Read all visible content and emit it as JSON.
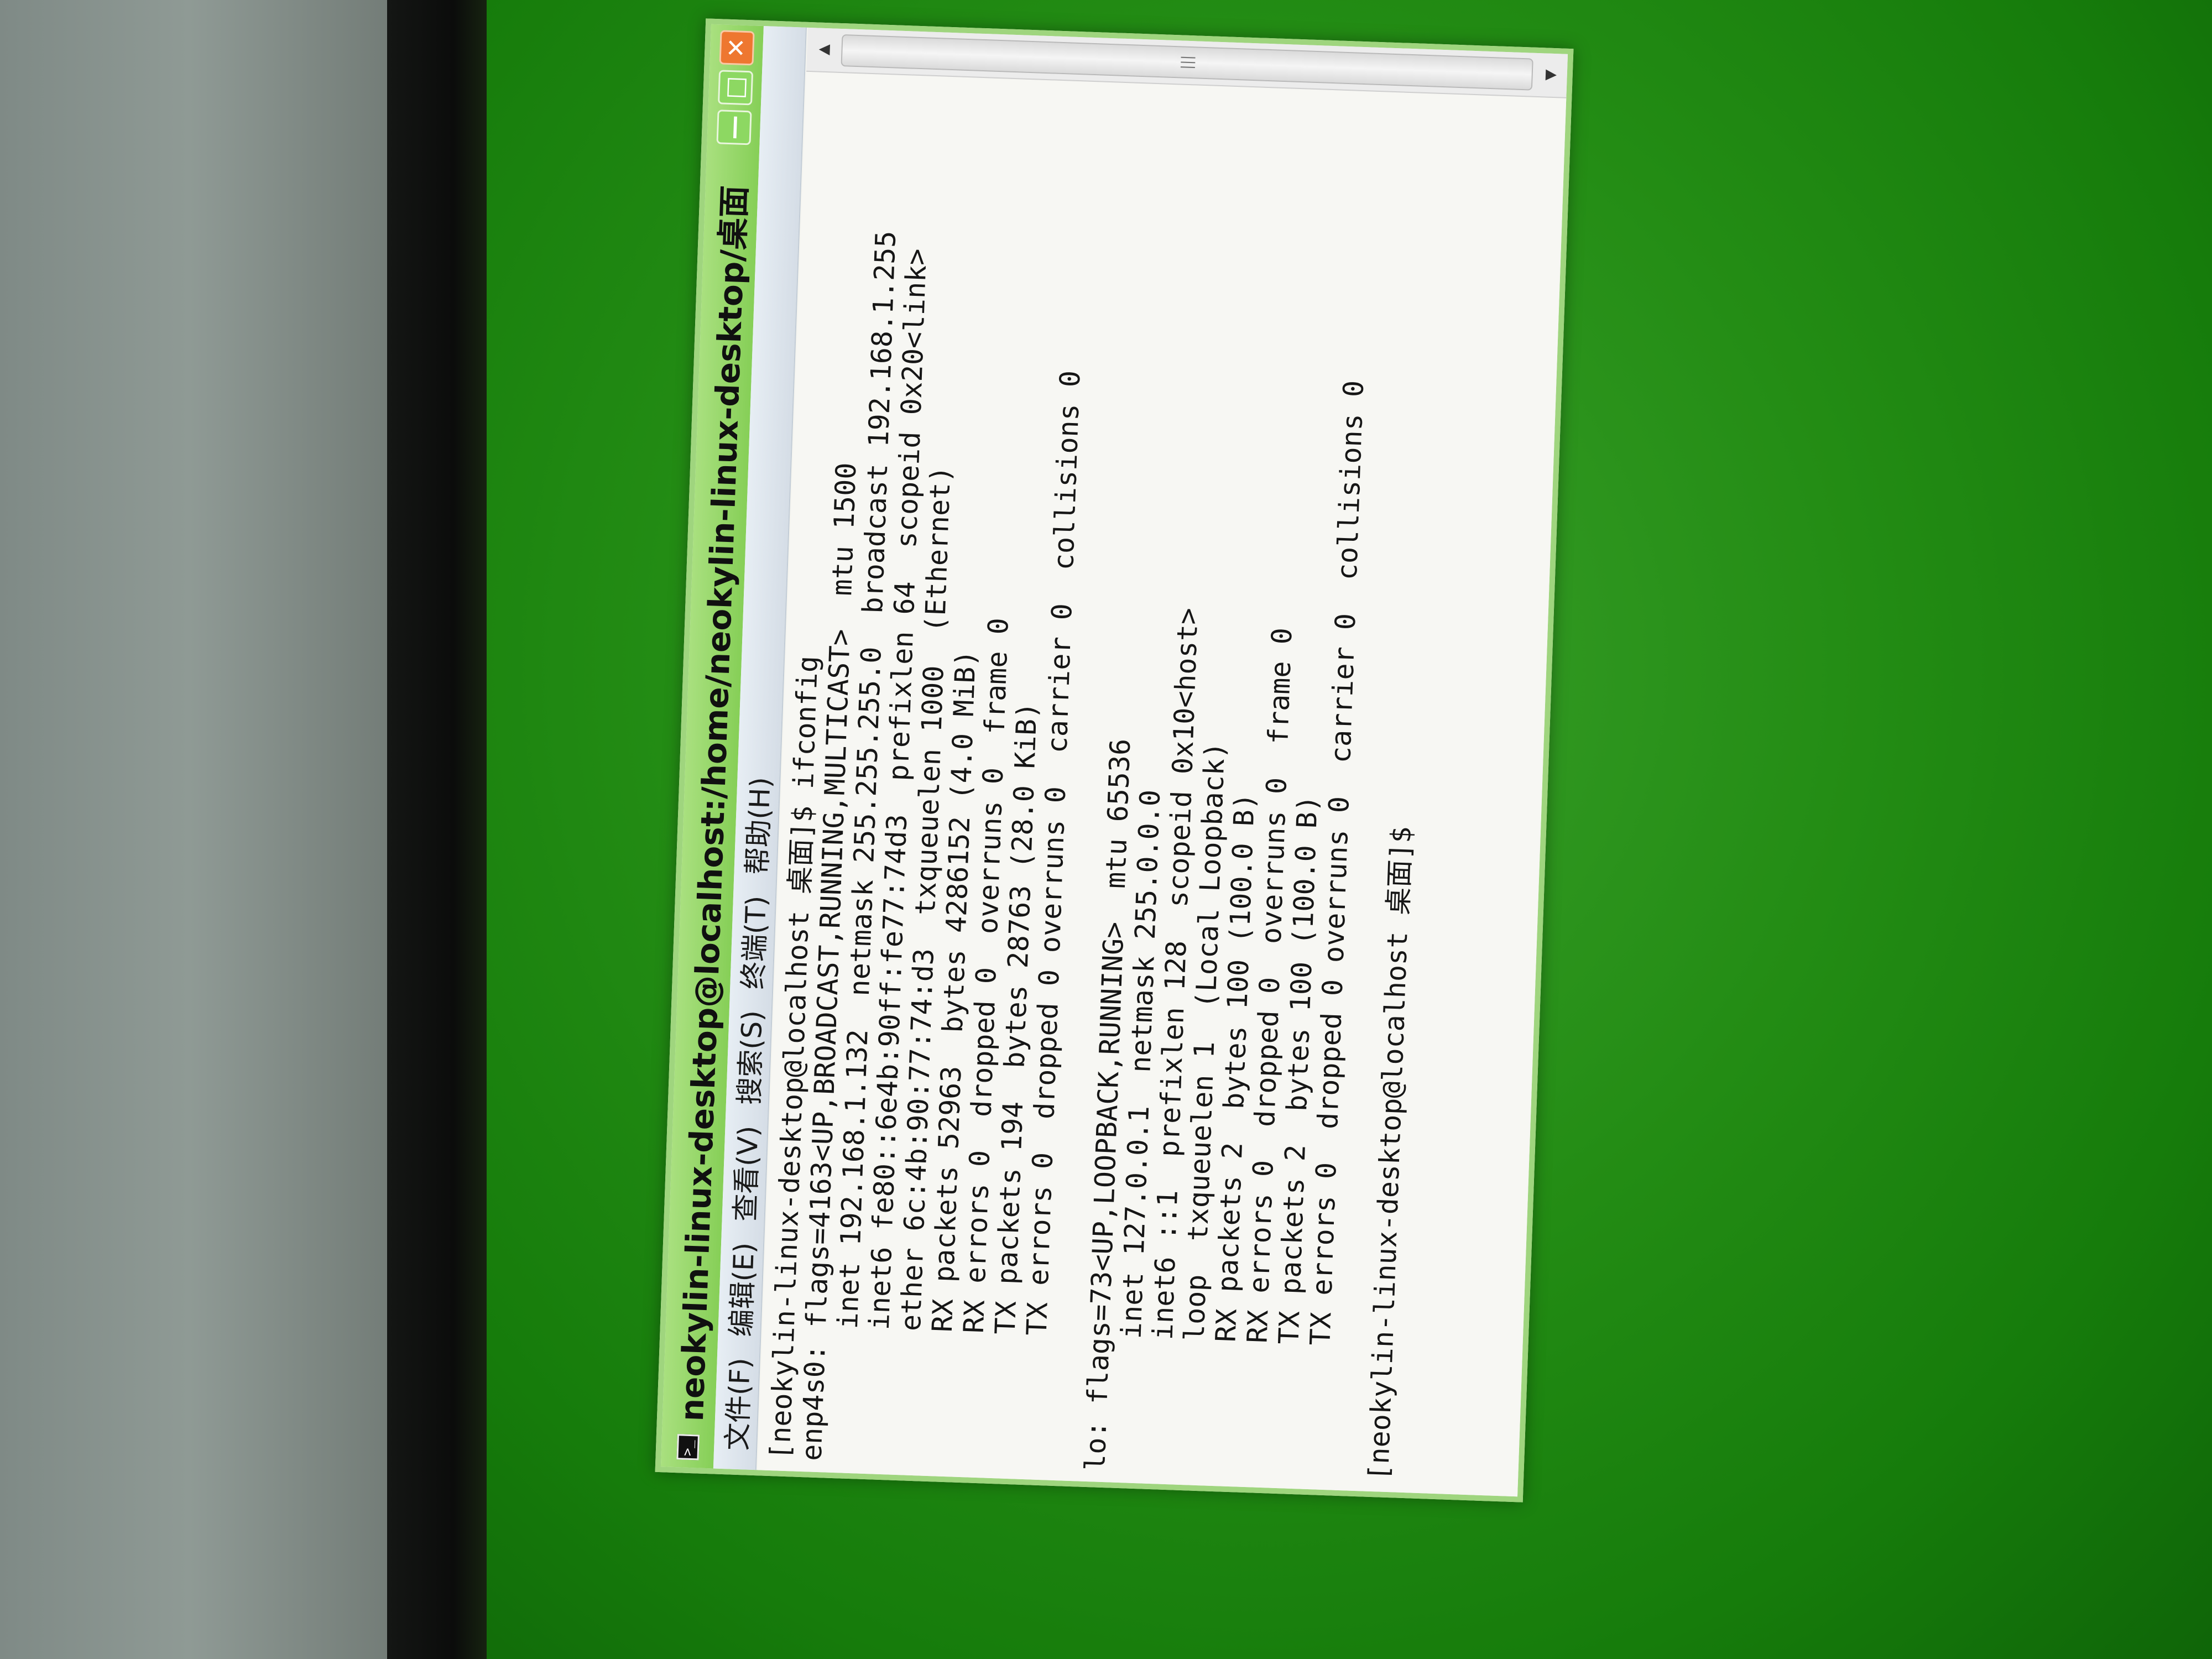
{
  "window": {
    "title": "neokylin-linux-desktop@localhost:/home/neokylin-linux-desktop/桌面",
    "icon": "terminal-icon",
    "controls": {
      "minimize": "—",
      "maximize": "□",
      "close": "✕"
    }
  },
  "menubar": {
    "items": [
      "文件(F)",
      "编辑(E)",
      "查看(V)",
      "搜索(S)",
      "终端(T)",
      "帮助(H)"
    ]
  },
  "terminal": {
    "lines": [
      "[neokylin-linux-desktop@localhost 桌面]$ ifconfig",
      "enp4s0: flags=4163<UP,BROADCAST,RUNNING,MULTICAST>  mtu 1500",
      "        inet 192.168.1.132  netmask 255.255.255.0  broadcast 192.168.1.255",
      "        inet6 fe80::6e4b:90ff:fe77:74d3  prefixlen 64  scopeid 0x20<link>",
      "        ether 6c:4b:90:77:74:d3  txqueuelen 1000  (Ethernet)",
      "        RX packets 52963  bytes 4286152 (4.0 MiB)",
      "        RX errors 0  dropped 0  overruns 0  frame 0",
      "        TX packets 194  bytes 28763 (28.0 KiB)",
      "        TX errors 0  dropped 0 overruns 0  carrier 0  collisions 0",
      "",
      "lo: flags=73<UP,LOOPBACK,RUNNING>  mtu 65536",
      "        inet 127.0.0.1  netmask 255.0.0.0",
      "        inet6 ::1  prefixlen 128  scopeid 0x10<host>",
      "        loop  txqueuelen 1  (Local Loopback)",
      "        RX packets 2  bytes 100 (100.0 B)",
      "        RX errors 0  dropped 0  overruns 0  frame 0",
      "        TX packets 2  bytes 100 (100.0 B)",
      "        TX errors 0  dropped 0 overruns 0  carrier 0  collisions 0",
      "",
      "[neokylin-linux-desktop@localhost 桌面]$"
    ]
  },
  "scrollbar": {
    "up_arrow": "▲",
    "down_arrow": "▼",
    "grip": "|||"
  }
}
